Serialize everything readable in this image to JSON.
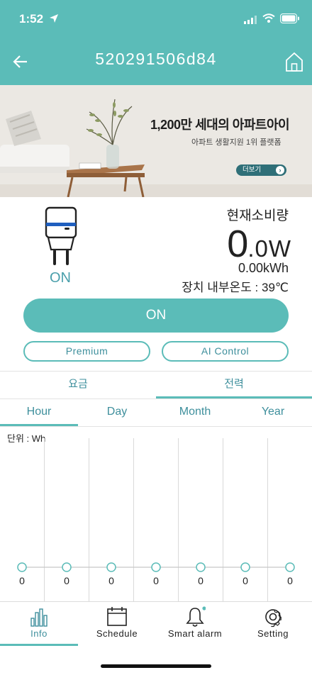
{
  "status_bar": {
    "time": "1:52"
  },
  "header": {
    "title": "520291506d84"
  },
  "banner": {
    "headline": "1,200만 세대의 아파트아이",
    "subtitle": "아파트 생활지원 1위 플랫폼",
    "more_label": "더보기"
  },
  "device": {
    "plug_state": "ON",
    "current_label": "현재소비량",
    "power_value": "0",
    "power_unit": ".0W",
    "energy": "0.00kWh",
    "temperature": "장치 내부온도 : 39℃"
  },
  "buttons": {
    "toggle_label": "ON",
    "premium_label": "Premium",
    "ai_label": "AI Control"
  },
  "tabs_primary": [
    {
      "label": "요금",
      "active": false
    },
    {
      "label": "전력",
      "active": true
    }
  ],
  "tabs_period": [
    {
      "label": "Hour",
      "active": true
    },
    {
      "label": "Day",
      "active": false
    },
    {
      "label": "Month",
      "active": false
    },
    {
      "label": "Year",
      "active": false
    }
  ],
  "chart_data": {
    "type": "line",
    "unit_label": "단위 : Wh",
    "points": 7,
    "values": [
      0,
      0,
      0,
      0,
      0,
      0,
      0
    ],
    "value_labels": [
      "0",
      "0",
      "0",
      "0",
      "0",
      "0",
      "0"
    ],
    "color": "#5bbcb8"
  },
  "bottom_nav": [
    {
      "label": "Info",
      "icon": "bar-chart-icon",
      "active": true
    },
    {
      "label": "Schedule",
      "icon": "calendar-icon",
      "active": false
    },
    {
      "label": "Smart alarm",
      "icon": "bell-icon",
      "active": false
    },
    {
      "label": "Setting",
      "icon": "gear-icon",
      "active": false
    }
  ],
  "colors": {
    "accent": "#5bbcb8",
    "accent_text": "#3e8f9c",
    "banner_button": "#2f6f78"
  }
}
